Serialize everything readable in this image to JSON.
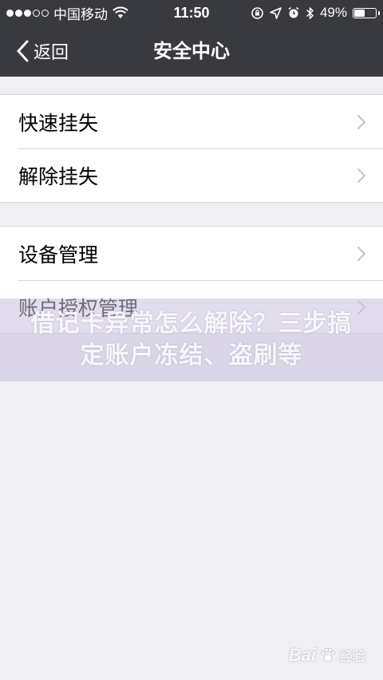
{
  "status_bar": {
    "carrier": "中国移动",
    "time": "11:50",
    "battery_percent": "49%",
    "battery_level": 0.49,
    "icons": [
      "signal-dots-icon",
      "wifi-icon",
      "rotation-lock-icon",
      "location-icon",
      "alarm-icon",
      "bluetooth-icon",
      "battery-icon"
    ]
  },
  "nav": {
    "back_label": "返回",
    "title": "安全中心"
  },
  "groups": [
    {
      "items": [
        {
          "label": "快速挂失"
        },
        {
          "label": "解除挂失"
        }
      ]
    },
    {
      "items": [
        {
          "label": "设备管理"
        },
        {
          "label": "账户授权管理"
        }
      ]
    }
  ],
  "overlay": {
    "text": "借记卡异常怎么解除？三步搞定账户冻结、盗刷等"
  },
  "watermark": {
    "latin": "Bai",
    "cjk": "经验"
  },
  "colors": {
    "header_bg": "#393a3f",
    "page_bg": "#efeff4",
    "separator": "#d9d9d9",
    "chevron": "#c7c7cc"
  }
}
